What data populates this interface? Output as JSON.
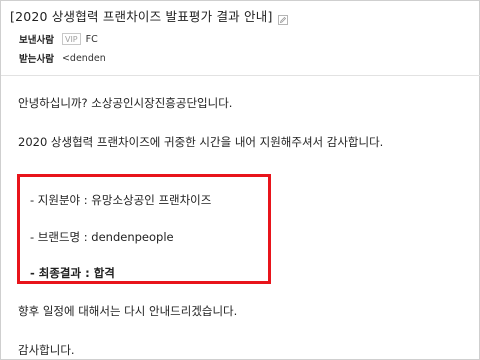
{
  "email": {
    "subject": "[2020 상생협력 프랜차이즈 발표평가 결과 안내]",
    "edit_icon": "pencil-icon",
    "sender_label": "보낸사람",
    "vip_badge": "VIP",
    "sender_value": "FC",
    "recipient_label": "받는사람",
    "recipient_value": "<denden"
  },
  "body": {
    "greeting": "안녕하십니까? 소상공인시장진흥공단입니다.",
    "thanks_line": "2020 상생협력 프랜차이즈에 귀중한 시간을 내어 지원해주셔서 감사합니다.",
    "field_line": "- 지원분야 :  유망소상공인 프랜차이즈",
    "brand_line": "- 브랜드명 : dendenpeople",
    "result_line": "- 최종결과 : 합격",
    "schedule_line": "향후 일정에 대해서는 다시 안내드리겠습니다.",
    "closing": "감사합니다."
  },
  "colors": {
    "highlight_border": "#e8141b",
    "divider": "#e2e2e2"
  }
}
